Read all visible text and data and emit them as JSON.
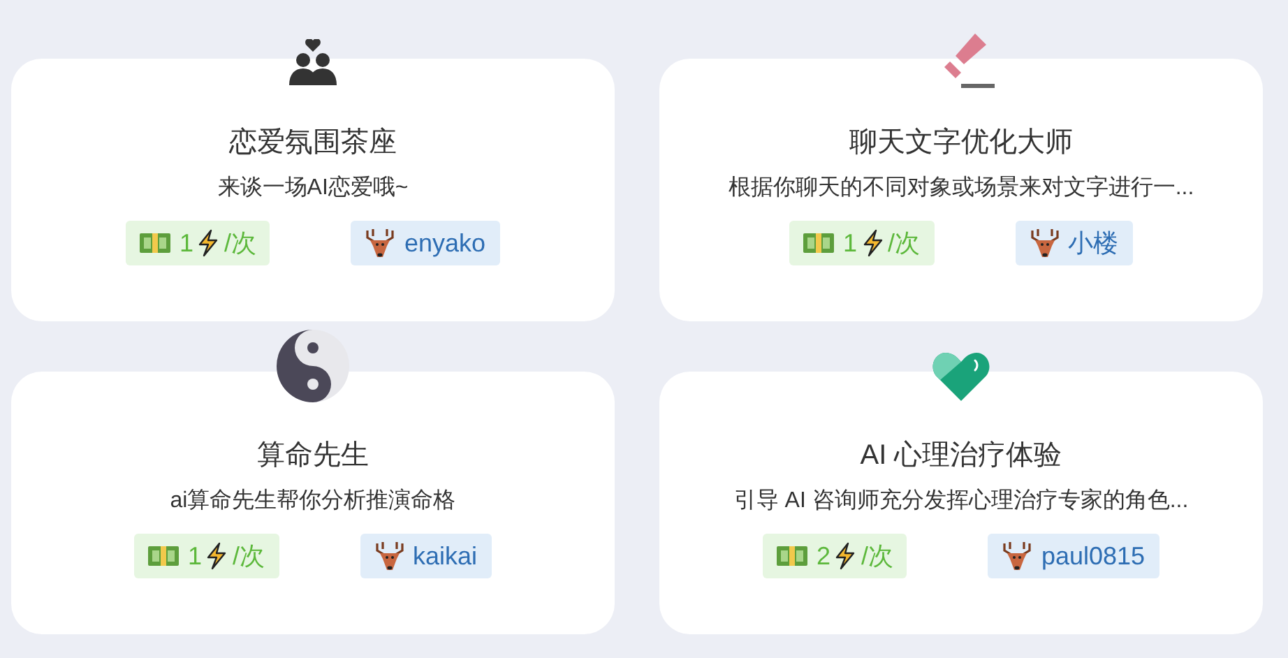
{
  "cards": [
    {
      "kind": "couple",
      "title": "恋爱氛围茶座",
      "description": "来谈一场AI恋爱哦~",
      "price": "1",
      "unit": "/次",
      "author": "enyako"
    },
    {
      "kind": "eraser",
      "title": "聊天文字优化大师",
      "description": "根据你聊天的不同对象或场景来对文字进行一...",
      "price": "1",
      "unit": "/次",
      "author": "小楼"
    },
    {
      "kind": "yinyang",
      "title": "算命先生",
      "description": "ai算命先生帮你分析推演命格",
      "price": "1",
      "unit": "/次",
      "author": "kaikai"
    },
    {
      "kind": "heart",
      "title": "AI 心理治疗体验",
      "description": "引导 AI 咨询师充分发挥心理治疗专家的角色...",
      "price": "2",
      "unit": "/次",
      "author": "paul0815"
    }
  ]
}
